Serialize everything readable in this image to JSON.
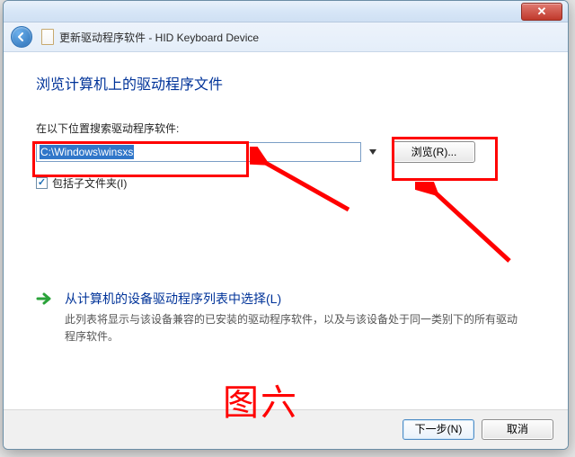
{
  "window": {
    "title": "更新驱动程序软件 - HID Keyboard Device"
  },
  "page": {
    "heading": "浏览计算机上的驱动程序文件",
    "search_label": "在以下位置搜索驱动程序软件:",
    "path_value": "C:\\Windows\\winsxs",
    "browse_label": "浏览(R)...",
    "include_subfolders_label": "包括子文件夹(I)"
  },
  "option": {
    "title": "从计算机的设备驱动程序列表中选择(L)",
    "desc": "此列表将显示与该设备兼容的已安装的驱动程序软件，以及与该设备处于同一类别下的所有驱动程序软件。"
  },
  "footer": {
    "next": "下一步(N)",
    "cancel": "取消"
  },
  "annotation": {
    "caption": "图六"
  }
}
